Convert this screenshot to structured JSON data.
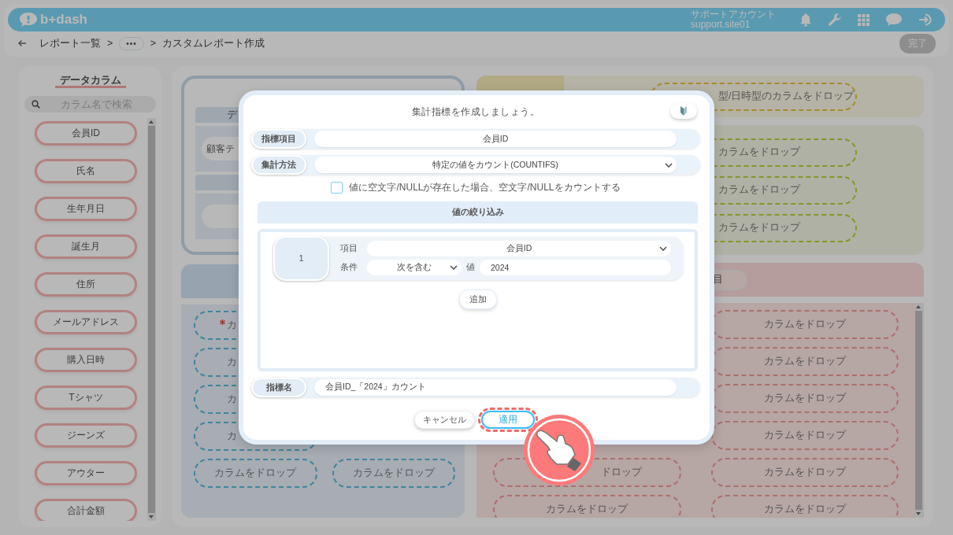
{
  "header": {
    "logo": "b+dash",
    "account_label": "サポートアカウント",
    "account_id": "support.site01"
  },
  "breadcrumb": [
    {
      "text": "レポート一覧",
      "kind": "link"
    },
    {
      "text": ">",
      "kind": "sep"
    },
    {
      "text": "•••",
      "kind": "more"
    },
    {
      "text": ">",
      "kind": "sep"
    },
    {
      "text": "カスタムレポート作成",
      "kind": "current"
    }
  ],
  "done_button": {
    "label": "完了",
    "disabled": true
  },
  "sidebar": {
    "title": "データカラム",
    "search_placeholder": "カラム名で検索",
    "items": [
      "会員ID",
      "氏名",
      "生年月日",
      "誕生月",
      "住所",
      "メールアドレス",
      "購入日時",
      "Tシャツ",
      "ジーンズ",
      "アウター",
      "合計金額"
    ]
  },
  "left_panel": {
    "section_label": "デ",
    "source_pill": "顧客テ"
  },
  "blue_zones": {
    "left": [
      {
        "text": "カ",
        "required": true
      },
      {
        "text": "カ",
        "required": false
      },
      {
        "text": "カ",
        "required": false
      },
      {
        "text": "カ",
        "required": false
      },
      {
        "text": "カラムをドロップ",
        "required": false
      }
    ],
    "right": [
      {
        "text": "カラムをドロップ",
        "required": false
      }
    ]
  },
  "yellow_zone": "型/日時型のカラムをドロップ",
  "green_zones": [
    "カラムをドロップ",
    "カラムをドロップ",
    "カラムをドロップ"
  ],
  "red_header_pill": "目",
  "red_zones": {
    "left": [
      "ドロップ",
      "カラムをドロップ"
    ],
    "right": [
      "カラムをドロップ",
      "カラムをドロップ",
      "カラムをドロップ",
      "カラムをドロップ",
      "カラムをドロップ",
      "カラムをドロップ"
    ]
  },
  "modal": {
    "title": "集計指標を作成しましょう。",
    "metric_item": {
      "label": "指標項目",
      "value": "会員ID"
    },
    "aggregation": {
      "label": "集計方法",
      "value": "特定の値をカウント(COUNTIFS)"
    },
    "count_empty": {
      "label": "値に空文字/NULLが存在した場合、空文字/NULLをカウントする",
      "checked": false
    },
    "filter_title": "値の絞り込み",
    "filters": [
      {
        "number": "1",
        "item_label": "項目",
        "item": "会員ID",
        "condition_label": "条件",
        "condition": "次を含む",
        "value_label": "値",
        "value": "2024"
      }
    ],
    "add_button": "追加",
    "metric_name": {
      "label": "指標名",
      "value": "会員ID_「2024」カウント"
    },
    "buttons": [
      {
        "label": "キャンセル",
        "kind": "secondary",
        "highlighted": false
      },
      {
        "label": "適用",
        "kind": "primary",
        "highlighted": true
      }
    ]
  }
}
